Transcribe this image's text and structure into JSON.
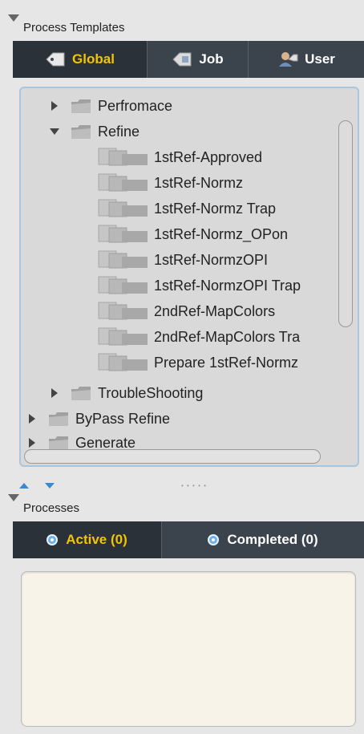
{
  "templates": {
    "title": "Process Templates",
    "tabs": [
      {
        "label": "Global",
        "icon": "tag-icon",
        "active": true
      },
      {
        "label": "Job",
        "icon": "job-tag-icon",
        "active": false
      },
      {
        "label": "User",
        "icon": "user-tag-icon",
        "active": false
      }
    ],
    "tree": {
      "perfromace": "Perfromace",
      "refine": "Refine",
      "refine_children": [
        "1stRef-Approved",
        "1stRef-Normz",
        "1stRef-Normz Trap",
        "1stRef-Normz_OPon",
        "1stRef-NormzOPI",
        "1stRef-NormzOPI Trap",
        "2ndRef-MapColors",
        "2ndRef-MapColors Tra",
        "Prepare 1stRef-Normz"
      ],
      "troubleshooting": "TroubleShooting",
      "bypass_refine": "ByPass Refine",
      "generate": "Generate"
    }
  },
  "processes": {
    "title": "Processes",
    "tabs": [
      {
        "label": "Active (0)",
        "active": true
      },
      {
        "label": "Completed (0)",
        "active": false
      }
    ]
  },
  "colors": {
    "tab_bar": "#3b434c",
    "active_tab_text": "#f3c400",
    "panel_border": "#a8c6de",
    "list_bg": "#d9d9d9"
  }
}
